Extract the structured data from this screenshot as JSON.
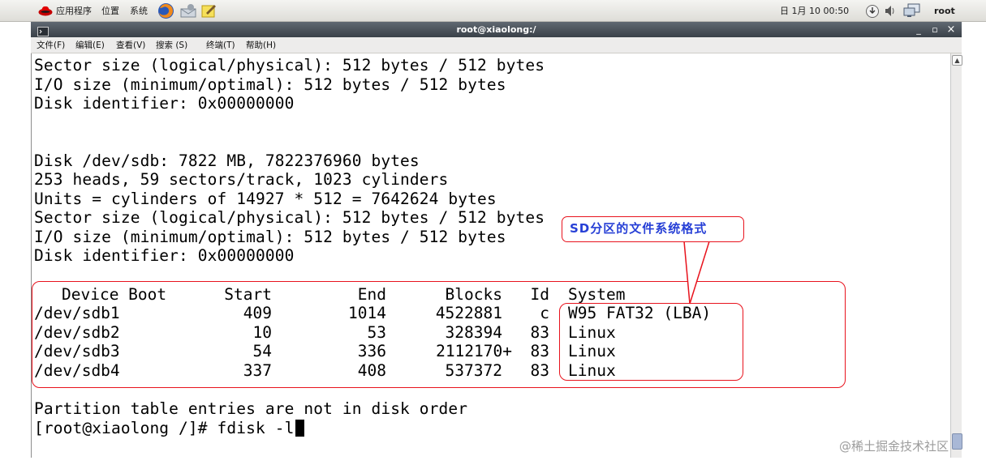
{
  "panel": {
    "menus": [
      "应用程序",
      "位置",
      "系统"
    ],
    "clock": "日 1月 10 00:50",
    "user": "root",
    "icons": [
      "redhat-logo-icon",
      "firefox-icon",
      "mail-icon",
      "notes-icon",
      "update-icon",
      "volume-icon",
      "network-icon"
    ]
  },
  "window": {
    "title": "root@xiaolong:/",
    "icon": "terminal-icon",
    "minimize": "_",
    "maximize": "▫",
    "close": "×"
  },
  "menubar": [
    "文件(F)",
    "编辑(E)",
    "查看(V)",
    "搜索 (S)",
    "终端(T)",
    "帮助(H)"
  ],
  "terminal": {
    "lines_top": [
      "Sector size (logical/physical): 512 bytes / 512 bytes",
      "I/O size (minimum/optimal): 512 bytes / 512 bytes",
      "Disk identifier: 0x00000000",
      "",
      "",
      "Disk /dev/sdb: 7822 MB, 7822376960 bytes",
      "253 heads, 59 sectors/track, 1023 cylinders",
      "Units = cylinders of 14927 * 512 = 7642624 bytes",
      "Sector size (logical/physical): 512 bytes / 512 bytes",
      "I/O size (minimum/optimal): 512 bytes / 512 bytes",
      "Disk identifier: 0x00000000",
      ""
    ],
    "table": {
      "headers": [
        "Device Boot",
        "Start",
        "End",
        "Blocks",
        "Id",
        "System"
      ],
      "rows": [
        [
          "/dev/sdb1",
          "409",
          "1014",
          "4522881",
          "c",
          "W95 FAT32 (LBA)"
        ],
        [
          "/dev/sdb2",
          "10",
          "53",
          "328394",
          "83",
          "Linux"
        ],
        [
          "/dev/sdb3",
          "54",
          "336",
          "2112170+",
          "83",
          "Linux"
        ],
        [
          "/dev/sdb4",
          "337",
          "408",
          "537372",
          "83",
          "Linux"
        ]
      ]
    },
    "lines_bottom": [
      "",
      "Partition table entries are not in disk order",
      "[root@xiaolong /]# fdisk -l"
    ]
  },
  "annotation": {
    "callout_label": "SD分区的文件系统格式",
    "color": "#e8131d",
    "text_color": "#2740d6"
  },
  "watermark": "@稀土掘金技术社区"
}
